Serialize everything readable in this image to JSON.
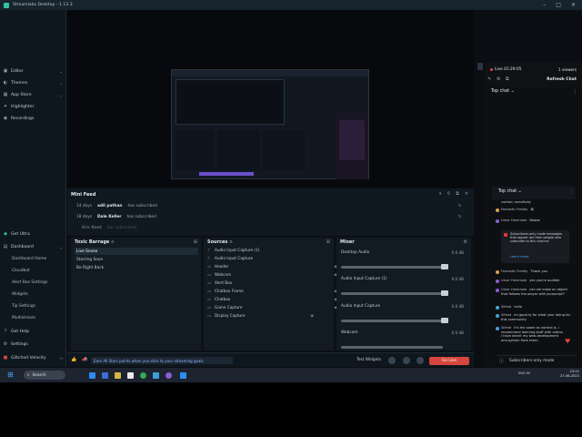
{
  "window": {
    "title": "Streamlabs Desktop - 1.13.3",
    "controls": [
      "–",
      "□",
      "✕"
    ]
  },
  "sidebar": {
    "top_items": [
      {
        "label": "Editor",
        "icon": "editor-icon"
      },
      {
        "label": "Themes",
        "icon": "themes-icon"
      },
      {
        "label": "App Store",
        "icon": "appstore-icon"
      },
      {
        "label": "Highlighter",
        "icon": "highlighter-icon"
      },
      {
        "label": "Recordings",
        "icon": "recordings-icon"
      }
    ],
    "bottom_items": [
      {
        "label": "Get Ultra"
      },
      {
        "label": "Dashboard"
      },
      {
        "label": "Dashboard Home"
      },
      {
        "label": "Cloudbot"
      },
      {
        "label": "Alert Box Settings"
      },
      {
        "label": "Widgets"
      },
      {
        "label": "Tip Settings"
      },
      {
        "label": "Multistream"
      },
      {
        "label": "Get Help"
      },
      {
        "label": "Settings"
      },
      {
        "label": "Glitched Velocity"
      }
    ]
  },
  "minifeed": {
    "title": "Mini Feed",
    "rows": [
      {
        "age": "14 days",
        "name": "adil pathan",
        "action": "has subscribed"
      },
      {
        "age": "18 days",
        "name": "Dale Keller",
        "action": "has subscribed"
      },
      {
        "age": "",
        "name": "Eric Kent",
        "action": "has subscribed"
      }
    ]
  },
  "scenes": {
    "title": "Toxic Barrage",
    "items": [
      "Live Scene",
      "Starting Soon",
      "Be Right Back"
    ]
  },
  "sources": {
    "title": "Sources",
    "items": [
      "Audio Input Capture (1)",
      "Audio Input Capture",
      "Header",
      "Webcam",
      "Alert Box",
      "Chatbox Frame",
      "Chatbox",
      "Game Capture",
      "Display Capture"
    ]
  },
  "mixer": {
    "title": "Mixer",
    "channels": [
      {
        "name": "Desktop Audio",
        "db": "0.0 dB",
        "level": 0.93
      },
      {
        "name": "Audio Input Capture (1)",
        "db": "0.0 dB",
        "level": 0.93
      },
      {
        "name": "Audio Input Capture",
        "db": "0.0 dB",
        "level": 0.93
      },
      {
        "name": "Webcam",
        "db": "0.0 dB",
        "level": 0.93
      }
    ]
  },
  "footer": {
    "promo": "Earn All Stars points when you stick to your streaming goals",
    "test_widgets": "Test Widgets",
    "go_live": "Go Live"
  },
  "chat": {
    "status": "Live 01:29:05",
    "viewers": "1 viewers",
    "refresh": "Refresh Chat",
    "top_chat": "Top chat",
    "top_chat2": "Top chat",
    "messages": [
      {
        "name": "",
        "text": "control, sensitivity",
        "color": "#888"
      },
      {
        "name": "Fantastic Freddy",
        "text": "😀",
        "color": "#d9a14a"
      },
      {
        "name": "Umar Hammala",
        "text": "Woww",
        "color": "#8a5fd1"
      },
      {
        "name": "Fantastic Freddy",
        "text": "Thank you",
        "color": "#d9a14a"
      },
      {
        "name": "Umar Hammala",
        "text": "yes you're audible",
        "color": "#8a5fd1"
      },
      {
        "name": "Umar Hammala",
        "text": "can we make an object that follows the player with javascript?",
        "color": "#8a5fd1"
      },
      {
        "name": "Sifeed",
        "text": "hello",
        "color": "#4aa3d9"
      },
      {
        "name": "Sifeed",
        "text": "im good ty for what your doing for this community",
        "color": "#4aa3d9"
      },
      {
        "name": "Sifeed",
        "text": "it's the same as normal js, i recommend learning stuff with mdms. I have learnt my web-development and python from them.",
        "color": "#4aa3d9"
      }
    ],
    "subs_notice": "Subscribers-only mode messages that appear are from people who subscribe to this channel",
    "learn_more": "Learn more",
    "input_placeholder": "Subscribers-only mode"
  },
  "taskbar": {
    "search": "Search",
    "tray": "ENG IN",
    "time": "23:22",
    "date": "27-06-2023"
  }
}
